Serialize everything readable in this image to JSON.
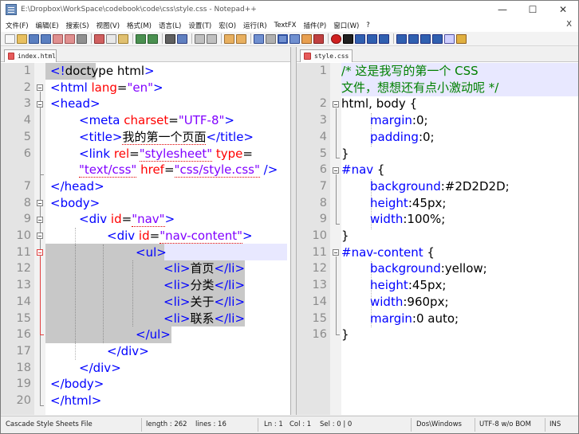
{
  "window": {
    "title": "E:\\Dropbox\\WorkSpace\\codebook\\code\\css\\style.css - Notepad++",
    "minimize": "—",
    "maximize": "☐",
    "close": "✕"
  },
  "menu": {
    "items": [
      "文件(F)",
      "编辑(E)",
      "搜索(S)",
      "视图(V)",
      "格式(M)",
      "语言(L)",
      "设置(T)",
      "宏(O)",
      "运行(R)",
      "TextFX",
      "插件(P)",
      "窗口(W)",
      "?"
    ],
    "close": "X"
  },
  "left_tab": {
    "label": "index.html"
  },
  "right_tab": {
    "label": "style.css"
  },
  "left_lines": [
    "1",
    "2",
    "3",
    "4",
    "5",
    "6",
    "7",
    "8",
    "9",
    "10",
    "11",
    "12",
    "13",
    "14",
    "15",
    "16",
    "17",
    "18",
    "19",
    "20"
  ],
  "right_lines": [
    "1",
    "2",
    "3",
    "4",
    "5",
    "6",
    "7",
    "8",
    "9",
    "10",
    "11",
    "12",
    "13",
    "14",
    "15",
    "16"
  ],
  "html_code": {
    "l1_a": "<!",
    "l1_b": "doctype html",
    "l1_c": ">",
    "l2_a": "<html ",
    "l2_b": "lang",
    "l2_c": "=",
    "l2_d": "\"en\"",
    "l2_e": ">",
    "l3": "<head>",
    "l4_a": "<meta ",
    "l4_b": "charset",
    "l4_c": "=",
    "l4_d": "\"UTF-8\"",
    "l4_e": ">",
    "l5_a": "<title>",
    "l5_b": "我的第一个页面",
    "l5_c": "</title>",
    "l6_a": "<link ",
    "l6_b": "rel",
    "l6_c": "=",
    "l6_d": "\"stylesheet\"",
    "l6_e": " type",
    "l6_f": "=",
    "l6w_a": "\"text/css\"",
    "l6w_b": " href",
    "l6w_c": "=",
    "l6w_d": "\"css/style.css\"",
    "l6w_e": " />",
    "l7": "</head>",
    "l8": "<body>",
    "l9_a": "<div ",
    "l9_b": "id",
    "l9_c": "=",
    "l9_d": "\"nav\"",
    "l9_e": ">",
    "l10_a": "<div ",
    "l10_b": "id",
    "l10_c": "=",
    "l10_d": "\"nav-content\"",
    "l10_e": ">",
    "l11": "<ul>",
    "l12_a": "<li>",
    "l12_b": "首页",
    "l12_c": "</li>",
    "l13_a": "<li>",
    "l13_b": "分类",
    "l13_c": "</li>",
    "l14_a": "<li>",
    "l14_b": "关于",
    "l14_c": "</li>",
    "l15_a": "<li>",
    "l15_b": "联系",
    "l15_c": "</li>",
    "l16": "</ul>",
    "l17": "</div>",
    "l18": "</div>",
    "l19": "</body>",
    "l20": "</html>"
  },
  "css_code": {
    "c1a": "/* 这是我写的第一个 CSS",
    "c1b": "文件，想想还有点小激动呢 */",
    "c2_a": "html, body",
    "c2_b": " {",
    "c3_a": "margin",
    "c3_b": ":0;",
    "c4_a": "padding",
    "c4_b": ":0;",
    "c5": "}",
    "c6_a": "#nav",
    "c6_b": " {",
    "c7_a": "background",
    "c7_b": ":#2D2D2D;",
    "c8_a": "height",
    "c8_b": ":45px;",
    "c9_a": "width",
    "c9_b": ":100%;",
    "c10": "}",
    "c11_a": "#nav-content",
    "c11_b": " {",
    "c12_a": "background",
    "c12_b": ":yellow;",
    "c13_a": "height",
    "c13_b": ":45px;",
    "c14_a": "width",
    "c14_b": ":960px;",
    "c15_a": "margin",
    "c15_b": ":0 auto;",
    "c16": "}"
  },
  "status": {
    "file_type": "Cascade Style Sheets File",
    "length": "length : 262",
    "lines": "lines : 16",
    "ln": "Ln : 1",
    "col": "Col : 1",
    "sel": "Sel : 0 | 0",
    "eol": "Dos\\Windows",
    "encoding": "UTF-8 w/o BOM",
    "mode": "INS"
  },
  "colors": {
    "tag": "#0000ff",
    "attribute": "#ff0000",
    "value": "#8000ff",
    "comment": "#008000",
    "selection": "#c8c8c8"
  }
}
